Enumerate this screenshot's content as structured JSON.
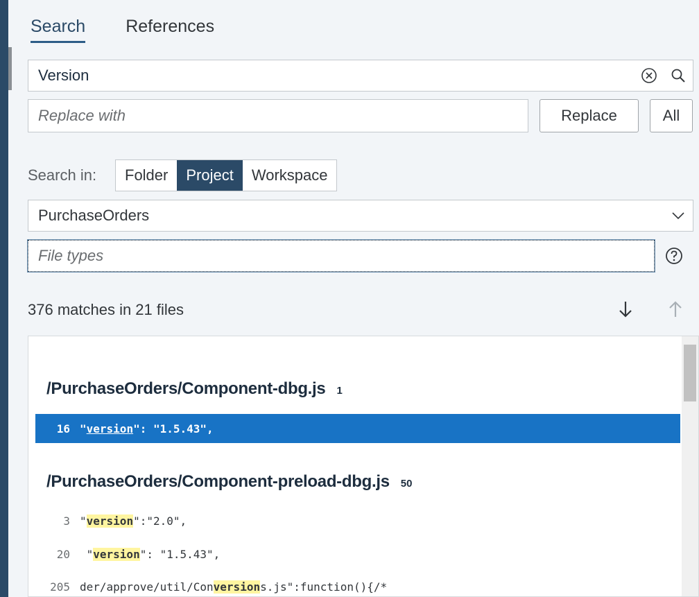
{
  "tabs": [
    {
      "label": "Search",
      "active": true
    },
    {
      "label": "References",
      "active": false
    }
  ],
  "search": {
    "value": "Version"
  },
  "replace": {
    "placeholder": "Replace with",
    "replace_label": "Replace",
    "all_label": "All"
  },
  "scope": {
    "label": "Search in:",
    "options": [
      "Folder",
      "Project",
      "Workspace"
    ],
    "selected": "Project"
  },
  "project": {
    "value": "PurchaseOrders"
  },
  "file_types": {
    "placeholder": "File types"
  },
  "results_summary": "376 matches in 21 files",
  "results": [
    {
      "file": "/PurchaseOrders/Component-dbg.js",
      "count": "1",
      "lines": [
        {
          "no": "16",
          "pre": "\"",
          "match": "version",
          "post": "\": \"1.5.43\",",
          "selected": true
        }
      ]
    },
    {
      "file": "/PurchaseOrders/Component-preload-dbg.js",
      "count": "50",
      "lines": [
        {
          "no": "3",
          "pre": "\"",
          "match": "version",
          "post": "\":\"2.0\",",
          "selected": false
        },
        {
          "no": "20",
          "pre": " \"",
          "match": "version",
          "post": "\": \"1.5.43\",",
          "selected": false
        },
        {
          "no": "205",
          "pre": "der/approve/util/Con",
          "match": "version",
          "post": "s.js\":function(){/*",
          "selected": false
        }
      ]
    }
  ],
  "colors": {
    "accent": "#2b4a67",
    "selection": "#1873c5",
    "highlight": "#fff5a0"
  }
}
